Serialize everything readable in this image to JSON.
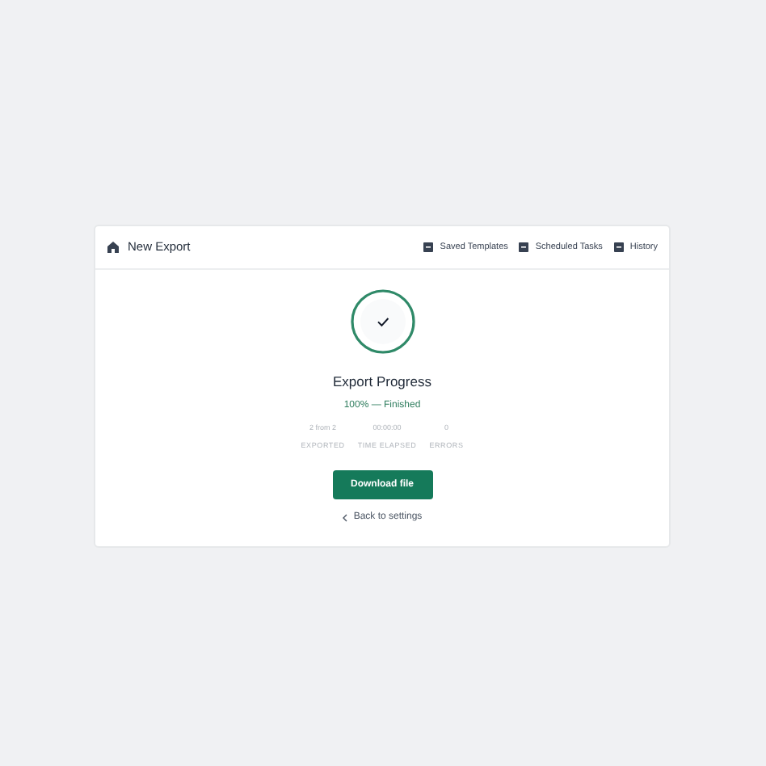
{
  "header": {
    "title": "New Export",
    "links": [
      {
        "label": "Saved Templates"
      },
      {
        "label": "Scheduled Tasks"
      },
      {
        "label": "History"
      }
    ]
  },
  "progress": {
    "level": 1,
    "complete": true,
    "title": "Export Progress",
    "status": "100% — Finished"
  },
  "stats": [
    {
      "value": "2 from 2",
      "label": "EXPORTED"
    },
    {
      "value": "00:00:00",
      "label": "TIME ELAPSED"
    },
    {
      "value": "0",
      "label": "ERRORS"
    }
  ],
  "primary_button": "Download file",
  "back_link": "Back to settings"
}
